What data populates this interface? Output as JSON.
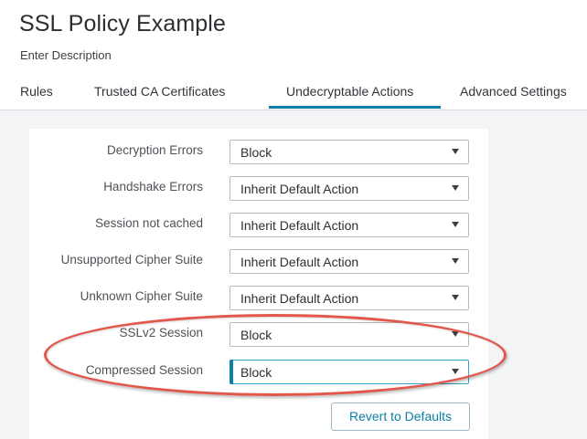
{
  "header": {
    "title": "SSL Policy Example",
    "description": "Enter Description"
  },
  "tabs": [
    {
      "label": "Rules",
      "active": false
    },
    {
      "label": "Trusted CA Certificates",
      "active": false
    },
    {
      "label": "Undecryptable Actions",
      "active": true
    },
    {
      "label": "Advanced Settings",
      "active": false
    }
  ],
  "rows": [
    {
      "label": "Decryption Errors",
      "value": "Block"
    },
    {
      "label": "Handshake Errors",
      "value": "Inherit Default Action"
    },
    {
      "label": "Session not cached",
      "value": "Inherit Default Action"
    },
    {
      "label": "Unsupported Cipher Suite",
      "value": "Inherit Default Action"
    },
    {
      "label": "Unknown Cipher Suite",
      "value": "Inherit Default Action"
    },
    {
      "label": "SSLv2 Session",
      "value": "Block"
    },
    {
      "label": "Compressed Session",
      "value": "Block"
    }
  ],
  "actions": {
    "revert_label": "Revert to Defaults"
  },
  "colors": {
    "accent": "#0c7fa6",
    "highlight": "#e2574c"
  }
}
